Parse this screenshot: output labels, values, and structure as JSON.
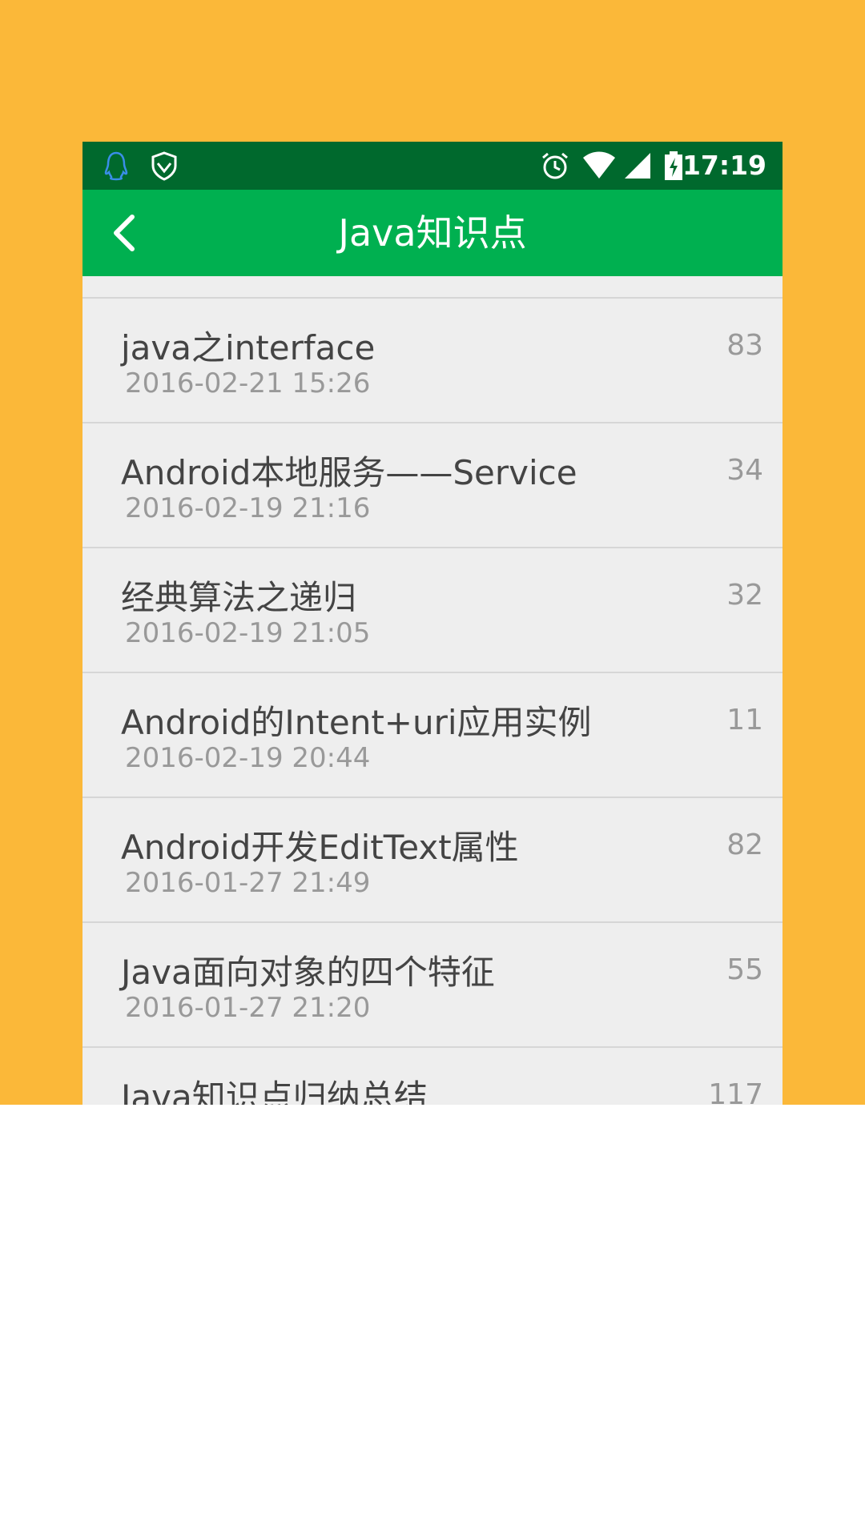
{
  "status_bar": {
    "time": "17:19",
    "icons": [
      "qq-icon",
      "shield-icon",
      "alarm-icon",
      "wifi-icon",
      "signal-icon",
      "battery-charging-icon"
    ],
    "background": "#00692d"
  },
  "app_bar": {
    "title": "Java知识点",
    "background": "#00b050"
  },
  "articles": [
    {
      "title": "java之interface",
      "date": "2016-02-21 15:26",
      "count": "83"
    },
    {
      "title": "Android本地服务——Service",
      "date": "2016-02-19 21:16",
      "count": "34"
    },
    {
      "title": "经典算法之递归",
      "date": "2016-02-19 21:05",
      "count": "32"
    },
    {
      "title": "Android的Intent+uri应用实例",
      "date": "2016-02-19 20:44",
      "count": "11"
    },
    {
      "title": "Android开发EditText属性",
      "date": "2016-01-27 21:49",
      "count": "82"
    },
    {
      "title": "Java面向对象的四个特征",
      "date": "2016-01-27 21:20",
      "count": "55"
    },
    {
      "title": "Java知识点归纳总结",
      "date": "",
      "count": "117"
    }
  ],
  "colors": {
    "backdrop": "#fbb839",
    "list_background": "#eeeeee"
  }
}
